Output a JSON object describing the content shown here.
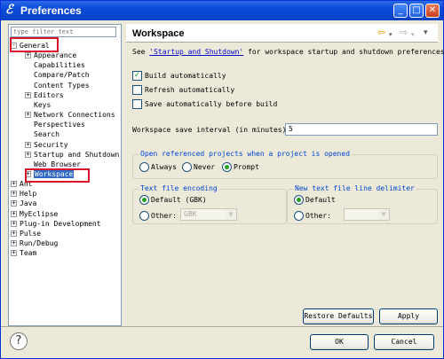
{
  "window": {
    "title": "Preferences"
  },
  "filter": {
    "placeholder": "type filter text"
  },
  "tree": [
    {
      "label": "General",
      "toggle": "-",
      "indent": 0
    },
    {
      "label": "Appearance",
      "toggle": "+",
      "indent": 1
    },
    {
      "label": "Capabilities",
      "toggle": "",
      "indent": 1
    },
    {
      "label": "Compare/Patch",
      "toggle": "",
      "indent": 1
    },
    {
      "label": "Content Types",
      "toggle": "",
      "indent": 1
    },
    {
      "label": "Editors",
      "toggle": "+",
      "indent": 1
    },
    {
      "label": "Keys",
      "toggle": "",
      "indent": 1
    },
    {
      "label": "Network Connections",
      "toggle": "+",
      "indent": 1
    },
    {
      "label": "Perspectives",
      "toggle": "",
      "indent": 1
    },
    {
      "label": "Search",
      "toggle": "",
      "indent": 1
    },
    {
      "label": "Security",
      "toggle": "+",
      "indent": 1
    },
    {
      "label": "Startup and Shutdown",
      "toggle": "+",
      "indent": 1
    },
    {
      "label": "Web Browser",
      "toggle": "",
      "indent": 1
    },
    {
      "label": "Workspace",
      "toggle": "+",
      "indent": 1,
      "selected": true
    },
    {
      "label": "Ant",
      "toggle": "+",
      "indent": 0
    },
    {
      "label": "Help",
      "toggle": "+",
      "indent": 0
    },
    {
      "label": "Java",
      "toggle": "+",
      "indent": 0
    },
    {
      "label": "MyEclipse",
      "toggle": "+",
      "indent": 0
    },
    {
      "label": "Plug-in Development",
      "toggle": "+",
      "indent": 0
    },
    {
      "label": "Pulse",
      "toggle": "+",
      "indent": 0
    },
    {
      "label": "Run/Debug",
      "toggle": "+",
      "indent": 0
    },
    {
      "label": "Team",
      "toggle": "+",
      "indent": 0
    }
  ],
  "page": {
    "title": "Workspace",
    "desc_prefix": "See ",
    "desc_link": "'Startup and Shutdown'",
    "desc_suffix": " for workspace startup and shutdown preferences.",
    "build_auto": "Build automatically",
    "refresh_auto": "Refresh automatically",
    "save_before_build": "Save automatically before build",
    "save_interval_label": "Workspace save interval (in minutes):",
    "save_interval_value": "5",
    "open_projects_group": "Open referenced projects when a project is opened",
    "opt_always": "Always",
    "opt_never": "Never",
    "opt_prompt": "Prompt",
    "encoding_group": "Text file encoding",
    "encoding_default": "Default (GBK)",
    "encoding_other": "Other:",
    "encoding_combo": "GBK",
    "delimiter_group": "New text file line delimiter",
    "delimiter_default": "Default",
    "delimiter_other": "Other:"
  },
  "buttons": {
    "restore": "Restore Defaults",
    "apply": "Apply",
    "ok": "OK",
    "cancel": "Cancel"
  },
  "colors": {
    "accent": "#316ac5",
    "highlight_box": "#d9142a",
    "title_bar": "#0a4ad8"
  }
}
